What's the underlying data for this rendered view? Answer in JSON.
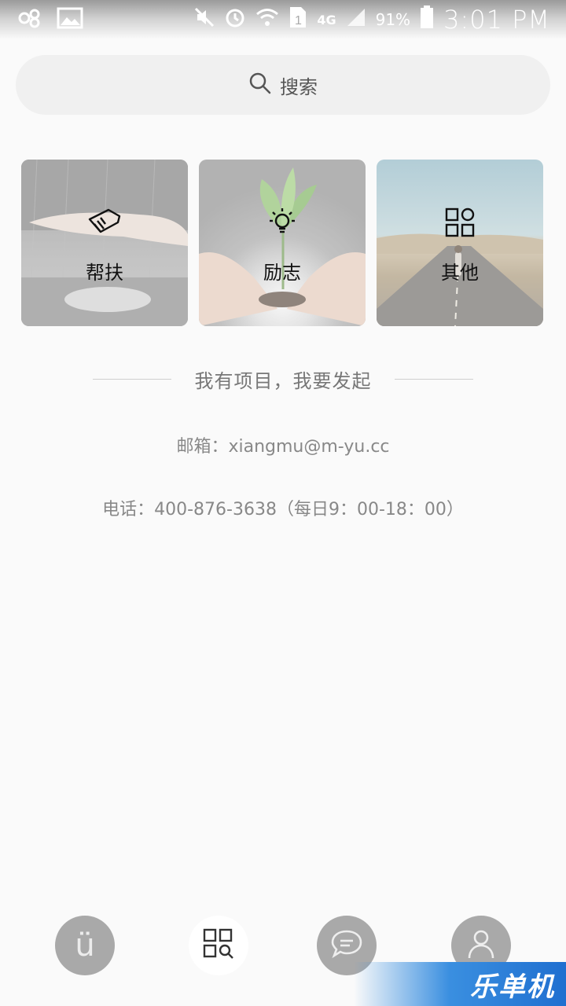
{
  "status_bar": {
    "network": "4G",
    "battery": "91%",
    "time": "3:01 PM"
  },
  "search": {
    "label": "搜索"
  },
  "categories": [
    {
      "label": "帮扶",
      "icon": "helping-hand-icon"
    },
    {
      "label": "励志",
      "icon": "lightbulb-icon"
    },
    {
      "label": "其他",
      "icon": "grid-icon"
    }
  ],
  "project": {
    "heading": "我有项目，我要发起",
    "email": "邮箱：xiangmu@m-yu.cc",
    "phone": "电话：400-876-3638（每日9：00-18：00）"
  },
  "bottom_nav": {
    "items": [
      {
        "label": "ü",
        "icon": "u-logo-icon"
      },
      {
        "label": "",
        "icon": "discover-icon",
        "active": true
      },
      {
        "label": "",
        "icon": "message-icon"
      },
      {
        "label": "",
        "icon": "profile-icon"
      }
    ]
  },
  "watermark": {
    "text": "乐单机"
  }
}
